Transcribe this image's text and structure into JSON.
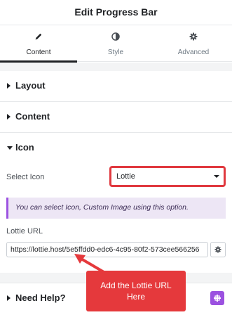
{
  "header": {
    "title": "Edit Progress Bar"
  },
  "tabs": [
    {
      "label": "Content",
      "icon": "pencil-icon",
      "active": true
    },
    {
      "label": "Style",
      "icon": "contrast-icon",
      "active": false
    },
    {
      "label": "Advanced",
      "icon": "gear-icon",
      "active": false
    }
  ],
  "sections": {
    "layout": {
      "title": "Layout"
    },
    "content": {
      "title": "Content"
    },
    "icon": {
      "title": "Icon"
    },
    "help": {
      "title": "Need Help?"
    }
  },
  "icon_section": {
    "select_label": "Select Icon",
    "select_value": "Lottie",
    "notice": "You can select Icon, Custom Image using this option.",
    "lottie_label": "Lottie URL",
    "lottie_value": "https://lottie.host/5e5ffdd0-edc6-4c95-80f2-573cee566256"
  },
  "callout": {
    "text": "Add the Lottie URL Here"
  },
  "colors": {
    "accent": "#9b51e0",
    "annotation_red": "#e5393c",
    "notice_bg": "#ede6f5"
  }
}
